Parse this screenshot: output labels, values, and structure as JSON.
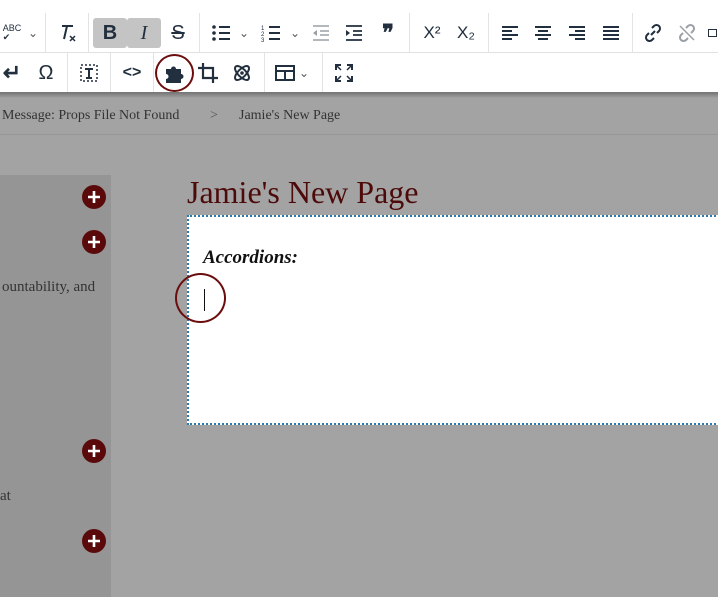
{
  "toolbar": {
    "row1": [
      {
        "name": "spellcheck-button",
        "icon": "spellcheck-icon",
        "glyph": "ABC"
      },
      {
        "name": "clear-formatting-button",
        "icon": "clear-formatting-icon"
      },
      {
        "name": "bold-button",
        "icon": "bold-icon",
        "glyph": "B",
        "active": true
      },
      {
        "name": "italic-button",
        "icon": "italic-icon",
        "glyph": "I",
        "active": true
      },
      {
        "name": "strikethrough-button",
        "icon": "strikethrough-icon",
        "glyph": "S"
      },
      {
        "name": "bullet-list-button",
        "icon": "bullet-list-icon"
      },
      {
        "name": "numbered-list-button",
        "icon": "numbered-list-icon"
      },
      {
        "name": "outdent-button",
        "icon": "outdent-icon"
      },
      {
        "name": "indent-button",
        "icon": "indent-icon"
      },
      {
        "name": "blockquote-button",
        "icon": "blockquote-icon",
        "glyph": "❞"
      },
      {
        "name": "superscript-button",
        "icon": "superscript-icon",
        "glyph": "X²"
      },
      {
        "name": "subscript-button",
        "icon": "subscript-icon",
        "glyph": "X₂"
      },
      {
        "name": "align-left-button",
        "icon": "align-left-icon"
      },
      {
        "name": "align-center-button",
        "icon": "align-center-icon"
      },
      {
        "name": "align-right-button",
        "icon": "align-right-icon"
      },
      {
        "name": "justify-button",
        "icon": "justify-icon"
      },
      {
        "name": "insert-link-button",
        "icon": "link-icon"
      },
      {
        "name": "remove-link-button",
        "icon": "unlink-icon"
      }
    ],
    "row2": [
      {
        "name": "line-break-button",
        "icon": "return-arrow-icon",
        "glyph": "↵"
      },
      {
        "name": "special-character-button",
        "icon": "omega-icon",
        "glyph": "Ω"
      },
      {
        "name": "template-button",
        "icon": "template-icon"
      },
      {
        "name": "source-code-button",
        "icon": "code-icon",
        "glyph": "<>"
      },
      {
        "name": "plugin-button",
        "icon": "puzzle-piece-icon"
      },
      {
        "name": "crop-button",
        "icon": "crop-icon"
      },
      {
        "name": "atom-button",
        "icon": "atom-icon"
      },
      {
        "name": "table-button",
        "icon": "table-icon"
      },
      {
        "name": "fullscreen-button",
        "icon": "fullscreen-icon"
      }
    ]
  },
  "breadcrumb": {
    "parent": "Message: Props File Not Found",
    "separator": ">",
    "current": "Jamie's New Page"
  },
  "left_panel": {
    "text1": "ountability, and",
    "text2": "at",
    "expand_icon": "plus-circle-icon"
  },
  "page": {
    "title": "Jamie's New Page"
  },
  "editor": {
    "heading": "Accordions:"
  },
  "colors": {
    "accent": "#5a0a0a",
    "title": "#4d0a0a",
    "overlay": "#a3a3a3",
    "editor_border": "#2d79a8",
    "highlight": "#6b0d0d"
  }
}
